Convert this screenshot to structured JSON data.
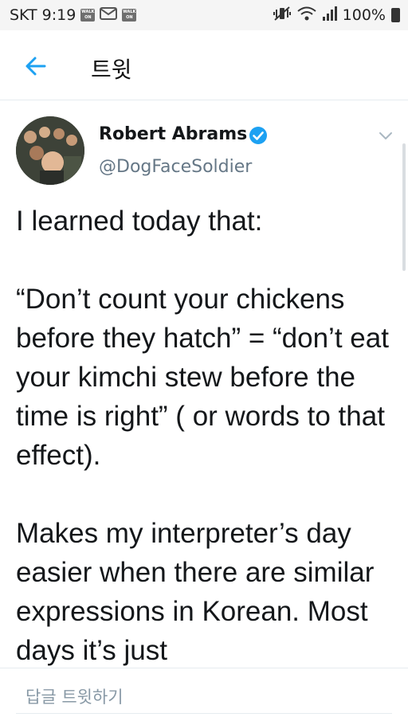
{
  "status_bar": {
    "carrier": "SKT",
    "time": "9:19",
    "walk_badge": "WALK ON",
    "battery": "100%"
  },
  "header": {
    "title": "트윗"
  },
  "tweet": {
    "author_name": "Robert Abrams",
    "handle": "@DogFaceSoldier",
    "text": "I learned today that:\n\n“Don’t count your chickens before they hatch” = “don’t eat your kimchi stew before the time is right” ( or words to that effect).\n\nMakes my interpreter’s day easier when there are similar expressions in Korean.  Most days it’s just"
  },
  "reply": {
    "placeholder": "답글 트윗하기"
  },
  "colors": {
    "accent": "#1da1f2",
    "text": "#14171a",
    "secondary": "#657786"
  }
}
